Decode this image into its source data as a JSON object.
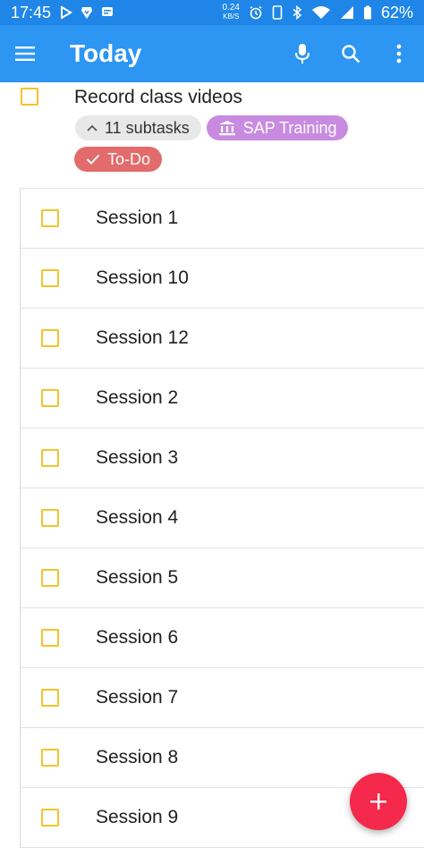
{
  "status_bar": {
    "time": "17:45",
    "net_speed_value": "0.24",
    "net_speed_unit": "KB/S",
    "battery": "62%"
  },
  "app_bar": {
    "title": "Today",
    "icons": [
      "menu-icon",
      "microphone-icon",
      "search-icon",
      "more-vert-icon"
    ]
  },
  "parent_task": {
    "title": "Record class videos",
    "subtasks_chip": "11 subtasks",
    "project_chip": "SAP Training",
    "label_chip": "To-Do"
  },
  "subtasks": [
    "Session 1",
    "Session 10",
    "Session 12",
    "Session 2",
    "Session 3",
    "Session 4",
    "Session 5",
    "Session 6",
    "Session 7",
    "Session 8",
    "Session 9"
  ],
  "colors": {
    "status_bar": "#1f86e8",
    "app_bar": "#2d95f2",
    "checkbox": "#f4c32b",
    "project_chip": "#c88be0",
    "label_chip": "#e26b6b",
    "fab": "#f5294b"
  }
}
